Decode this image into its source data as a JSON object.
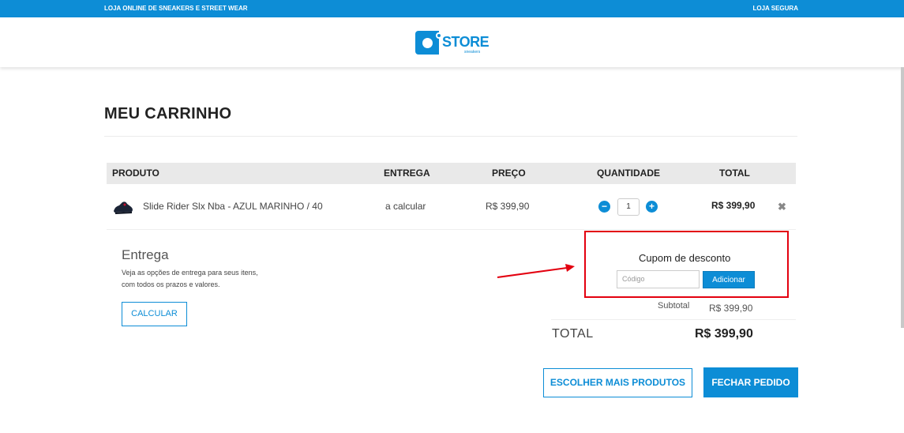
{
  "topbar": {
    "left_text": "LOJA ONLINE DE SNEAKERS E STREET WEAR",
    "right_text": "LOJA SEGURA"
  },
  "logo": {
    "word": "STORE",
    "sub": "sneakers"
  },
  "page_title": "MEU CARRINHO",
  "table": {
    "headers": [
      "PRODUTO",
      "ENTREGA",
      "PREÇO",
      "QUANTIDADE",
      "TOTAL"
    ],
    "rows": [
      {
        "product": "Slide Rider Slx Nba - AZUL MARINHO / 40",
        "delivery": "a calcular",
        "price": "R$ 399,90",
        "quantity": "1",
        "total": "R$ 399,90",
        "icon": "sandal-product-image"
      }
    ]
  },
  "entrega": {
    "title": "Entrega",
    "line1": "Veja as opções de entrega para seus itens,",
    "line2": "com todos os prazos e valores.",
    "button": "CALCULAR"
  },
  "coupon": {
    "title": "Cupom de desconto",
    "placeholder": "Código",
    "button": "Adicionar",
    "highlight_color": "#e3000f"
  },
  "summary": {
    "subtotal_label": "Subtotal",
    "subtotal_value": "R$ 399,90",
    "total_label": "TOTAL",
    "total_value": "R$ 399,90"
  },
  "actions": {
    "more_products": "ESCOLHER MAIS PRODUTOS",
    "checkout": "FECHAR PEDIDO"
  },
  "colors": {
    "accent": "#0d8dd6",
    "annotation": "#e3000f"
  }
}
